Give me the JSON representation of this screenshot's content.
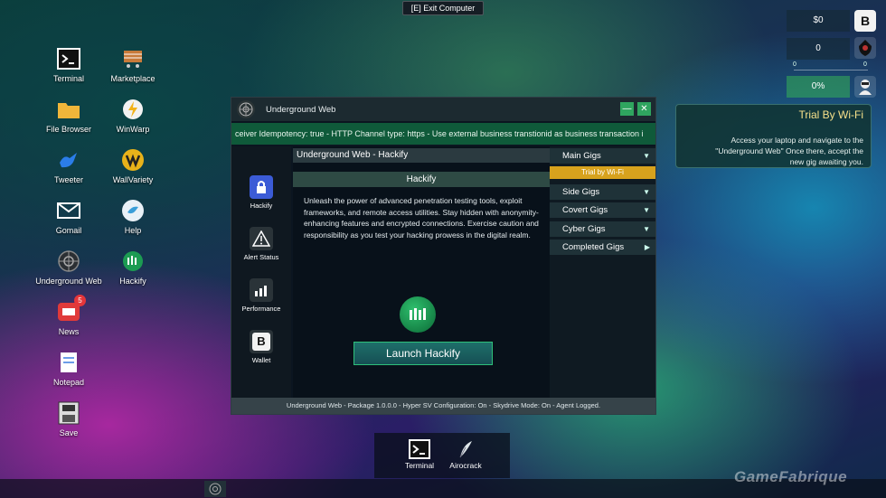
{
  "exit_hint": "[E] Exit Computer",
  "desktop_icons": [
    {
      "label": "Terminal"
    },
    {
      "label": "Marketplace"
    },
    {
      "label": "File Browser"
    },
    {
      "label": "WinWarp"
    },
    {
      "label": "Tweeter"
    },
    {
      "label": "WallVariety"
    },
    {
      "label": "Gomail"
    },
    {
      "label": "Help"
    },
    {
      "label": "Underground Web"
    },
    {
      "label": "Hackify"
    },
    {
      "label": "News",
      "badge": "5"
    },
    {
      "label": "Notepad"
    },
    {
      "label": "Save"
    }
  ],
  "hud": {
    "money": "$0",
    "suspicion": "0",
    "range_min": "0",
    "range_max": "0",
    "progress": "0%",
    "progress_fraction": 0
  },
  "quest": {
    "title": "Trial By Wi-Fi",
    "body": "Access your laptop and navigate to the \"Underground Web\" Once there, accept the new gig awaiting you."
  },
  "window": {
    "title": "Underground Web",
    "minimize_symbol": "—",
    "close_symbol": "✕",
    "ticker": "ceiver Idempotency: true - HTTP Channel type: https - Use external business transtionid as business transaction i",
    "sidebar": [
      {
        "label": "Hackify",
        "icon": "lock-icon"
      },
      {
        "label": "Alert Status",
        "icon": "warning-icon"
      },
      {
        "label": "Performance",
        "icon": "chart-icon"
      },
      {
        "label": "Wallet",
        "icon": "wallet-icon"
      }
    ],
    "content": {
      "header": "Underground Web - Hackify",
      "subheader": "Hackify",
      "description": "Unleash the power of advanced penetration testing tools, exploit frameworks, and remote access utilities. Stay hidden with anonymity-enhancing features and encrypted connections. Exercise caution and responsibility as you test your hacking prowess in the digital realm.",
      "launch_label": "Launch Hackify"
    },
    "gigs": {
      "main": "Main Gigs",
      "active": "Trial by Wi-Fi",
      "side": "Side Gigs",
      "covert": "Covert Gigs",
      "cyber": "Cyber Gigs",
      "completed": "Completed Gigs"
    },
    "status": "Underground Web - Package 1.0.0.0 - Hyper SV Configuration: On - Skydrive Mode: On - Agent Logged."
  },
  "dock": [
    {
      "label": "Terminal"
    },
    {
      "label": "Airocrack"
    }
  ],
  "watermark": "GameFabrique",
  "colors": {
    "accent_green": "#2fa55f",
    "ticker_green": "#0f5a3a",
    "active_gig": "#d7a21d",
    "quest_title": "#f6e08a"
  }
}
